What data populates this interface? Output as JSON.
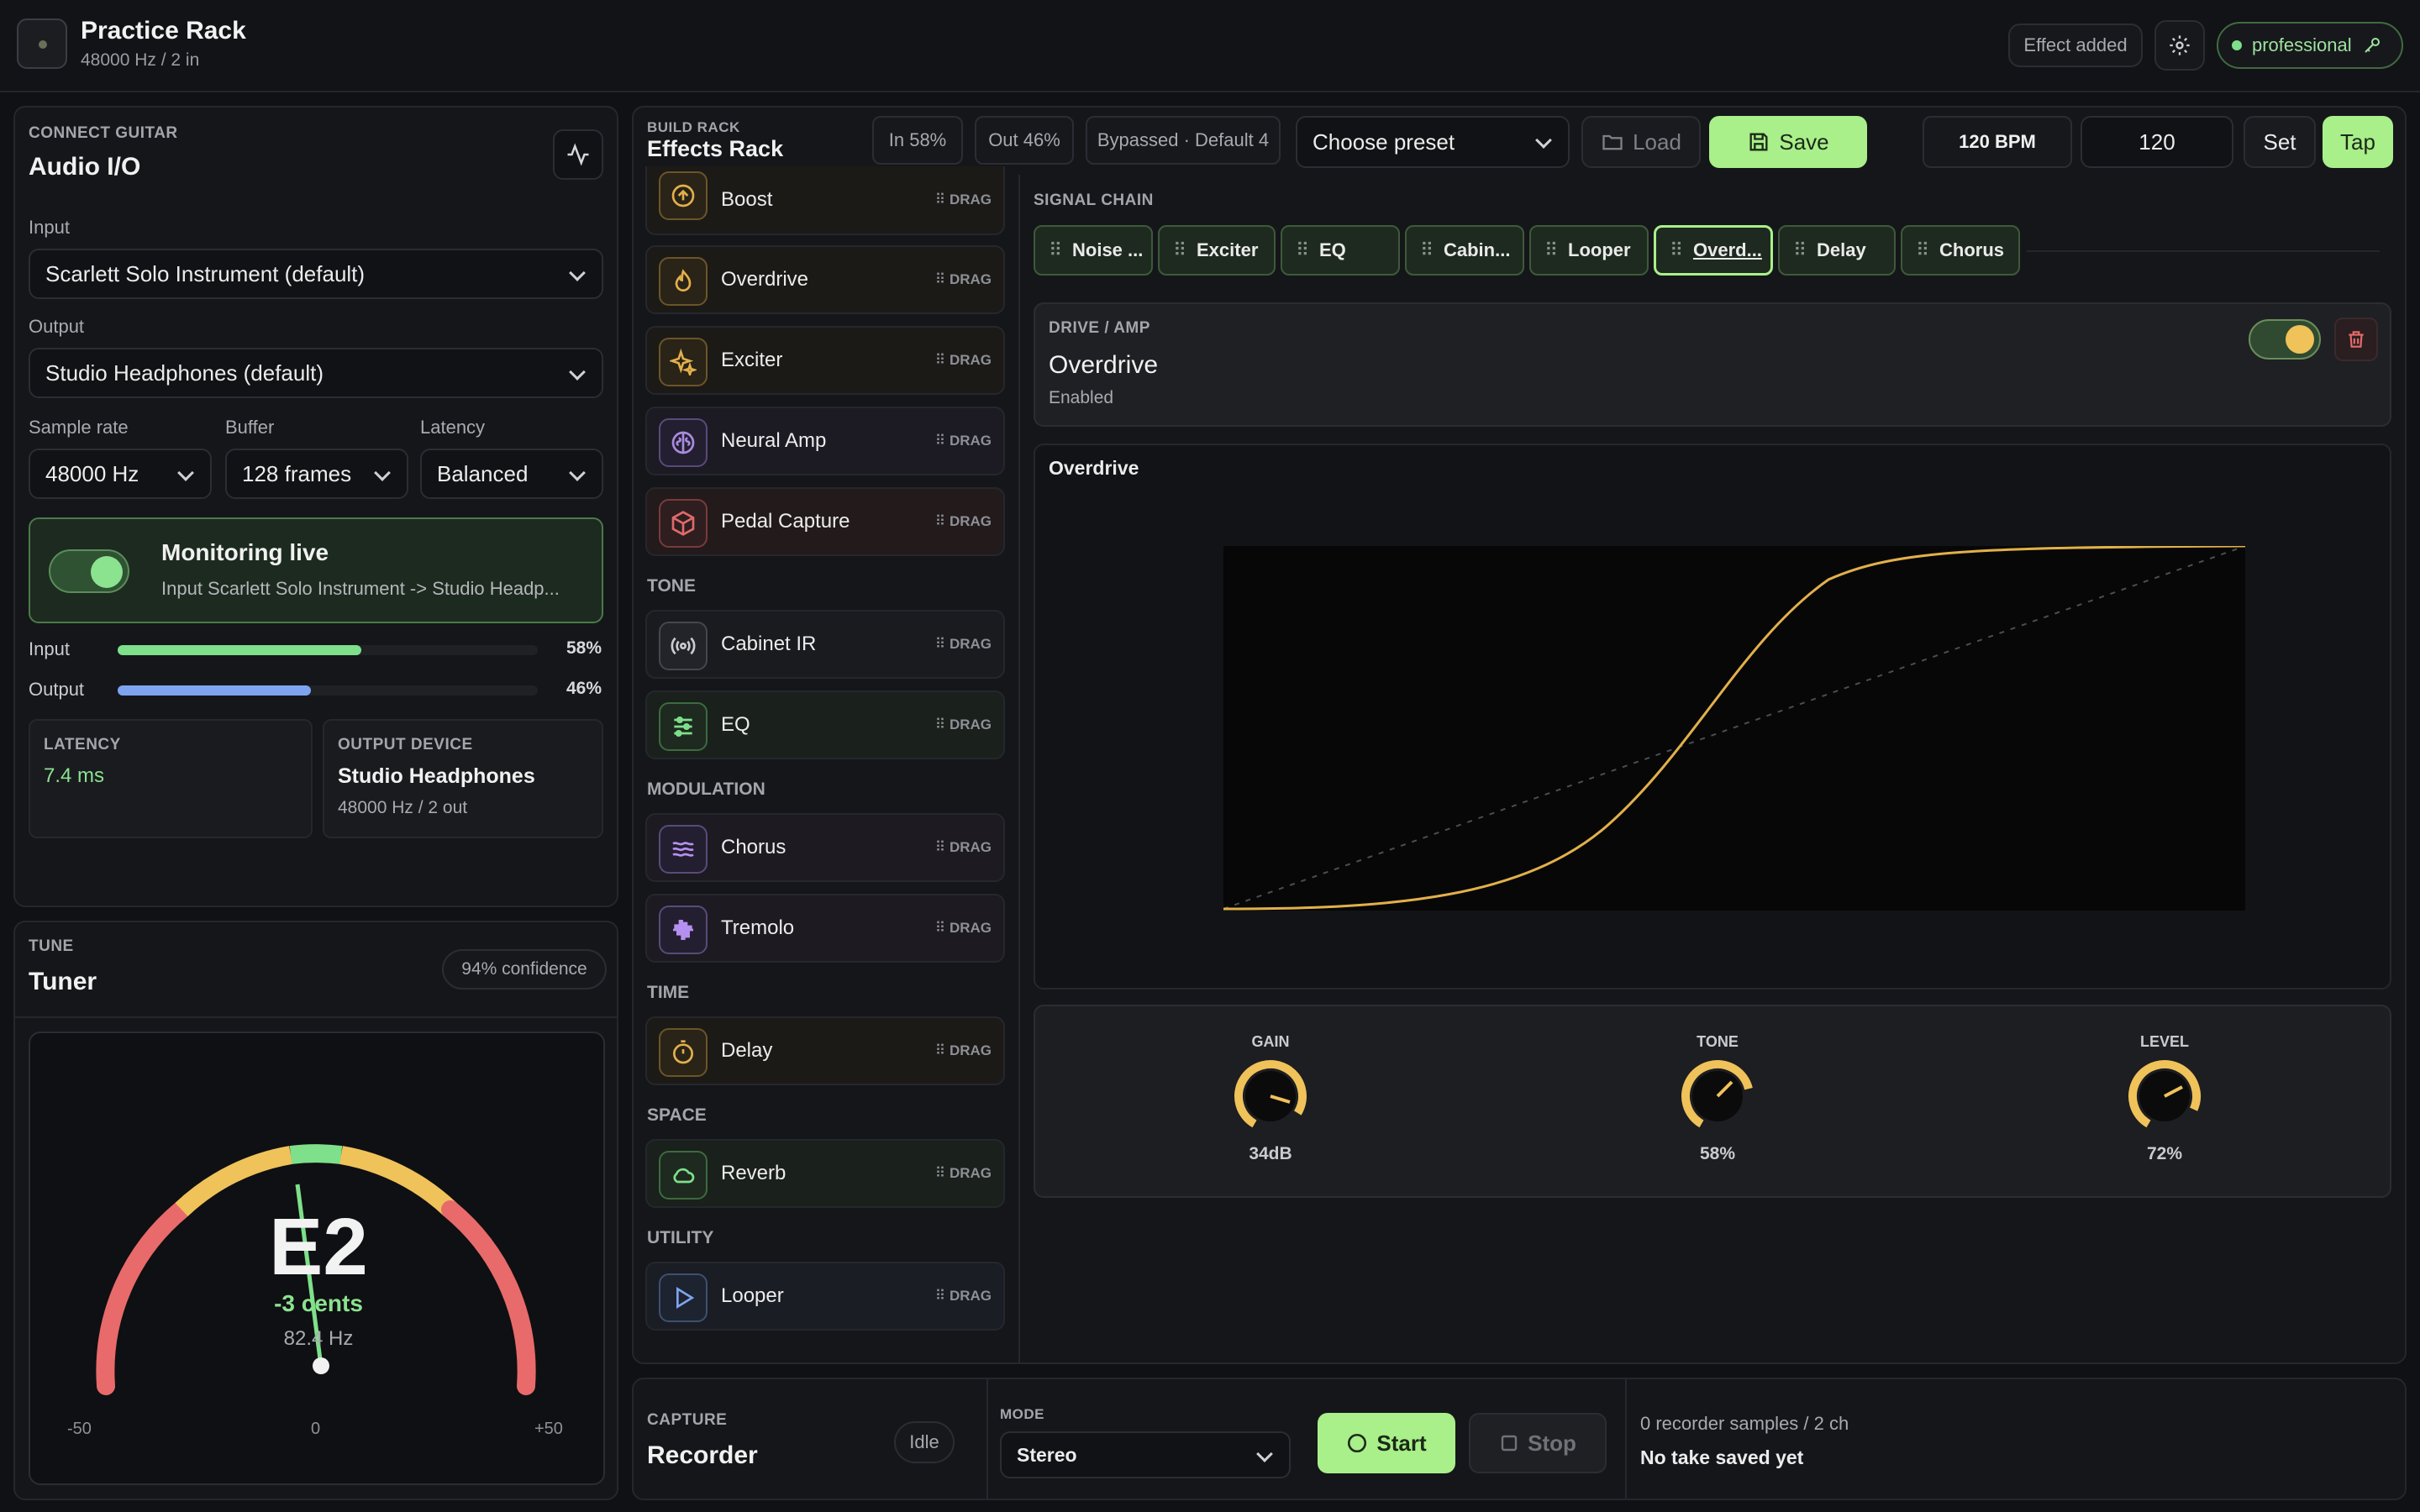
{
  "app": {
    "title": "Practice Rack",
    "subtitle": "48000 Hz / 2 in",
    "status": "Effect added",
    "license": "professional"
  },
  "io": {
    "caption": "CONNECT GUITAR",
    "title": "Audio I/O",
    "input_label": "Input",
    "input_value": "Scarlett Solo Instrument (default)",
    "output_label": "Output",
    "output_value": "Studio Headphones (default)",
    "sample_rate_label": "Sample rate",
    "sample_rate": "48000 Hz",
    "buffer_label": "Buffer",
    "buffer": "128 frames",
    "latency_label": "Latency",
    "latency_mode": "Balanced",
    "monitor_title": "Monitoring live",
    "monitor_sub": "Input Scarlett Solo Instrument -> Studio Headp...",
    "meter_input_label": "Input",
    "meter_input_pct": "58%",
    "meter_input_level": 0.58,
    "meter_output_label": "Output",
    "meter_output_pct": "46%",
    "meter_output_level": 0.46,
    "latency_caption": "LATENCY",
    "latency_value": "7.4 ms",
    "outdev_caption": "OUTPUT DEVICE",
    "outdev_name": "Studio Headphones",
    "outdev_sub": "48000 Hz / 2 out"
  },
  "tuner": {
    "caption": "TUNE",
    "title": "Tuner",
    "confidence": "94% confidence",
    "note": "E2",
    "cents": "-3 cents",
    "hz": "82.4 Hz",
    "scale_left": "-50",
    "scale_mid": "0",
    "scale_right": "+50"
  },
  "rack": {
    "caption": "BUILD RACK",
    "title": "Effects Rack",
    "in_level": "In 58%",
    "out_level": "Out 46%",
    "bypass": "Bypassed · Default 4",
    "preset": "Choose preset",
    "load": "Load",
    "save": "Save",
    "bpm": "120 BPM",
    "bpm_input": "120",
    "set": "Set",
    "tap": "Tap",
    "drag": "DRAG",
    "groups": {
      "tone": "TONE",
      "modulation": "MODULATION",
      "time": "TIME",
      "space": "SPACE",
      "utility": "UTILITY"
    },
    "effects": {
      "boost": "Boost",
      "overdrive": "Overdrive",
      "exciter": "Exciter",
      "neural": "Neural Amp",
      "capture": "Pedal Capture",
      "cab": "Cabinet IR",
      "eq": "EQ",
      "chorus": "Chorus",
      "tremolo": "Tremolo",
      "delay": "Delay",
      "reverb": "Reverb",
      "looper": "Looper"
    },
    "colors": {
      "drive": "#e2b04a",
      "amp": "#a98be0",
      "capture": "#e06a6a",
      "tone": "#7ee08a",
      "mod": "#b690f0",
      "time": "#e2b04a",
      "space": "#7ee08a",
      "utility": "#7ea4f0"
    }
  },
  "chain": {
    "caption": "SIGNAL CHAIN",
    "items": [
      "Noise ...",
      "Exciter",
      "EQ",
      "Cabin...",
      "Looper",
      "Overd...",
      "Delay",
      "Chorus"
    ]
  },
  "detail": {
    "caption": "DRIVE / AMP",
    "name": "Overdrive",
    "state": "Enabled",
    "curve_title": "Overdrive",
    "knobs": [
      {
        "label": "GAIN",
        "value": "34dB"
      },
      {
        "label": "TONE",
        "value": "58%"
      },
      {
        "label": "LEVEL",
        "value": "72%"
      }
    ]
  },
  "recorder": {
    "caption": "CAPTURE",
    "title": "Recorder",
    "state": "Idle",
    "mode_caption": "MODE",
    "mode": "Stereo",
    "start": "Start",
    "stop": "Stop",
    "samples": "0 recorder samples / 2 ch",
    "take": "No take saved yet"
  }
}
